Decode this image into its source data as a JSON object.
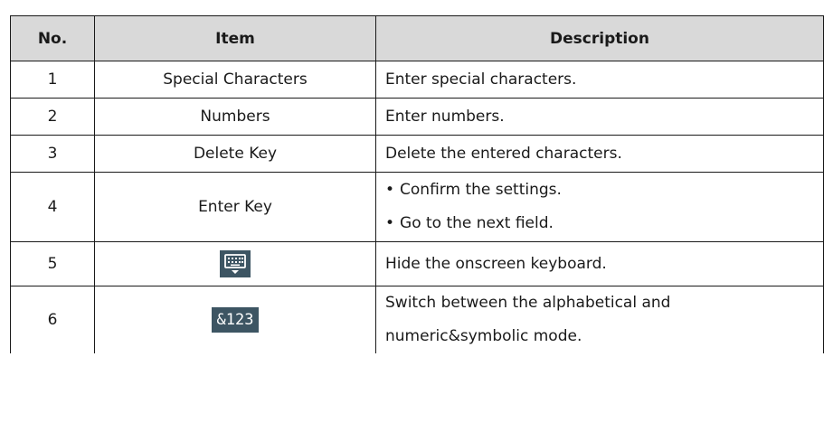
{
  "table": {
    "headers": {
      "no": "No.",
      "item": "Item",
      "description": "Description"
    },
    "rows": [
      {
        "no": "1",
        "item": "Special Characters",
        "description": "Enter special characters."
      },
      {
        "no": "2",
        "item": "Numbers",
        "description": "Enter numbers."
      },
      {
        "no": "3",
        "item": "Delete Key",
        "description": "Delete the entered characters."
      },
      {
        "no": "4",
        "item": "Enter Key",
        "bullets": [
          "Confirm the settings.",
          "Go to the next field."
        ]
      },
      {
        "no": "5",
        "item_icon": "hide-keyboard-icon",
        "description": "Hide the onscreen keyboard."
      },
      {
        "no": "6",
        "item_icon_label": "&123",
        "description_lines": [
          "Switch between the alphabetical and",
          "numeric&symbolic mode."
        ]
      }
    ],
    "colors": {
      "header_bg": "#d9d9d9",
      "icon_bg": "#3d5563",
      "border": "#1a1a1a"
    }
  }
}
